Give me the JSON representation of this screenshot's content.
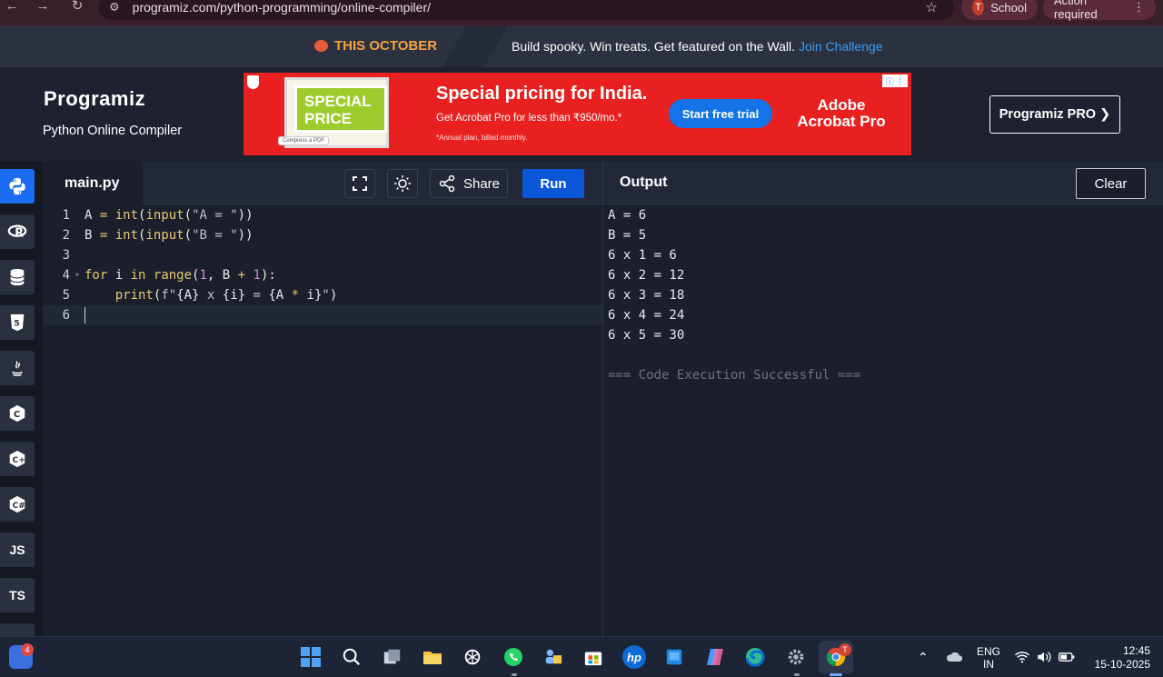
{
  "browser": {
    "url": "programiz.com/python-programming/online-compiler/",
    "profile_initial": "T",
    "profile_label": "School",
    "action_label": "Action required"
  },
  "promo": {
    "highlight": "THIS OCTOBER",
    "message": "Build spooky. Win treats. Get featured on the Wall.",
    "link": "Join Challenge"
  },
  "header": {
    "logo": "Programiz",
    "subtitle": "Python Online Compiler",
    "pro_button": "Programiz PRO ❯"
  },
  "ad": {
    "stamp_text": "SPECIAL PRICE",
    "stamp_chip": "Compress a PDF",
    "headline": "Special pricing for India.",
    "sub": "Get Acrobat Pro for less than ₹950/mo.*",
    "fine": "*Annual plan, billed monthly.",
    "cta": "Start free trial",
    "brand": "Adobe Acrobat Pro"
  },
  "languages": [
    {
      "name": "python",
      "label": ""
    },
    {
      "name": "r",
      "label": ""
    },
    {
      "name": "sql",
      "label": ""
    },
    {
      "name": "html",
      "label": ""
    },
    {
      "name": "java",
      "label": ""
    },
    {
      "name": "c",
      "label": ""
    },
    {
      "name": "cpp",
      "label": ""
    },
    {
      "name": "csharp",
      "label": ""
    },
    {
      "name": "js",
      "label": "JS"
    },
    {
      "name": "ts",
      "label": "TS"
    }
  ],
  "editor": {
    "filename": "main.py",
    "share_label": "Share",
    "run_label": "Run",
    "lines": [
      {
        "num": "1",
        "code": "A = int(input(\"A = \"))"
      },
      {
        "num": "2",
        "code": "B = int(input(\"B = \"))"
      },
      {
        "num": "3",
        "code": ""
      },
      {
        "num": "4",
        "code": "for i in range(1, B + 1):"
      },
      {
        "num": "5",
        "code": "    print(f\"{A} x {i} = {A * i}\")"
      },
      {
        "num": "6",
        "code": ""
      }
    ]
  },
  "output": {
    "title": "Output",
    "clear_label": "Clear",
    "lines": [
      "A = 6",
      "B = 5",
      "6 x 1 = 6",
      "6 x 2 = 12",
      "6 x 3 = 18",
      "6 x 4 = 24",
      "6 x 5 = 30",
      "",
      "=== Code Execution Successful ==="
    ]
  },
  "taskbar": {
    "widget_badge": "4",
    "chrome_badge": "T",
    "lang_line1": "ENG",
    "lang_line2": "IN",
    "time": "12:45",
    "date": "15-10-2025"
  }
}
